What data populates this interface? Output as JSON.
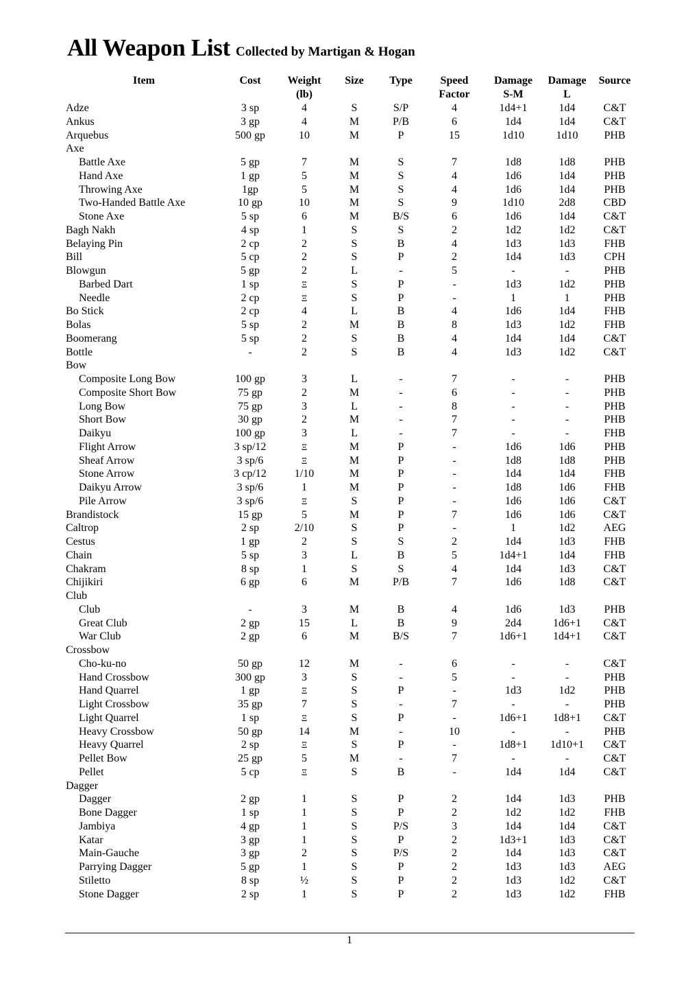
{
  "document": {
    "title": "All Weapon List",
    "subtitle": "Collected by Martigan & Hogan",
    "page_number": "1"
  },
  "table": {
    "headers": {
      "item": "Item",
      "cost": "Cost",
      "weight": [
        "Weight",
        "(lb)"
      ],
      "size": "Size",
      "type": "Type",
      "speed": [
        "Speed",
        "Factor"
      ],
      "damage_sm": [
        "Damage",
        "S-M"
      ],
      "damage_l": [
        "Damage",
        "L"
      ],
      "source": "Source"
    },
    "rows": [
      {
        "item": "Adze",
        "sub": false,
        "cost": "3 sp",
        "weight": "4",
        "size": "S",
        "type": "S/P",
        "speed": "4",
        "dsm": "1d4+1",
        "dl": "1d4",
        "source": "C&T"
      },
      {
        "item": "Ankus",
        "sub": false,
        "cost": "3 gp",
        "weight": "4",
        "size": "M",
        "type": "P/B",
        "speed": "6",
        "dsm": "1d4",
        "dl": "1d4",
        "source": "C&T"
      },
      {
        "item": "Arquebus",
        "sub": false,
        "cost": "500 gp",
        "weight": "10",
        "size": "M",
        "type": "P",
        "speed": "15",
        "dsm": "1d10",
        "dl": "1d10",
        "source": "PHB"
      },
      {
        "item": "Axe",
        "sub": false,
        "group": true
      },
      {
        "item": "Battle Axe",
        "sub": true,
        "cost": "5 gp",
        "weight": "7",
        "size": "M",
        "type": "S",
        "speed": "7",
        "dsm": "1d8",
        "dl": "1d8",
        "source": "PHB"
      },
      {
        "item": "Hand Axe",
        "sub": true,
        "cost": "1 gp",
        "weight": "5",
        "size": "M",
        "type": "S",
        "speed": "4",
        "dsm": "1d6",
        "dl": "1d4",
        "source": "PHB"
      },
      {
        "item": "Throwing Axe",
        "sub": true,
        "cost": "1gp",
        "weight": "5",
        "size": "M",
        "type": "S",
        "speed": "4",
        "dsm": "1d6",
        "dl": "1d4",
        "source": "PHB"
      },
      {
        "item": "Two-Handed Battle Axe",
        "sub": true,
        "cost": "10 gp",
        "weight": "10",
        "size": "M",
        "type": "S",
        "speed": "9",
        "dsm": "1d10",
        "dl": "2d8",
        "source": "CBD"
      },
      {
        "item": "Stone Axe",
        "sub": true,
        "cost": "5 sp",
        "weight": "6",
        "size": "M",
        "type": "B/S",
        "speed": "6",
        "dsm": "1d6",
        "dl": "1d4",
        "source": "C&T"
      },
      {
        "item": "Bagh Nakh",
        "sub": false,
        "cost": "4 sp",
        "weight": "1",
        "size": "S",
        "type": "S",
        "speed": "2",
        "dsm": "1d2",
        "dl": "1d2",
        "source": "C&T"
      },
      {
        "item": "Belaying Pin",
        "sub": false,
        "cost": "2 cp",
        "weight": "2",
        "size": "S",
        "type": "B",
        "speed": "4",
        "dsm": "1d3",
        "dl": "1d3",
        "source": "FHB"
      },
      {
        "item": "Bill",
        "sub": false,
        "cost": "5 cp",
        "weight": "2",
        "size": "S",
        "type": "P",
        "speed": "2",
        "dsm": "1d4",
        "dl": "1d3",
        "source": "CPH"
      },
      {
        "item": "Blowgun",
        "sub": false,
        "cost": "5 gp",
        "weight": "2",
        "size": "L",
        "type": "-",
        "speed": "5",
        "dsm": "-",
        "dl": "-",
        "source": "PHB"
      },
      {
        "item": "Barbed Dart",
        "sub": true,
        "cost": "1 sp",
        "weight": "Ξ",
        "size": "S",
        "type": "P",
        "speed": "-",
        "dsm": "1d3",
        "dl": "1d2",
        "source": "PHB"
      },
      {
        "item": "Needle",
        "sub": true,
        "cost": "2 cp",
        "weight": "Ξ",
        "size": "S",
        "type": "P",
        "speed": "-",
        "dsm": "1",
        "dl": "1",
        "source": "PHB"
      },
      {
        "item": "Bo Stick",
        "sub": false,
        "cost": "2 cp",
        "weight": "4",
        "size": "L",
        "type": "B",
        "speed": "4",
        "dsm": "1d6",
        "dl": "1d4",
        "source": "FHB"
      },
      {
        "item": "Bolas",
        "sub": false,
        "cost": "5 sp",
        "weight": "2",
        "size": "M",
        "type": "B",
        "speed": "8",
        "dsm": "1d3",
        "dl": "1d2",
        "source": "FHB"
      },
      {
        "item": "Boomerang",
        "sub": false,
        "cost": "5 sp",
        "weight": "2",
        "size": "S",
        "type": "B",
        "speed": "4",
        "dsm": "1d4",
        "dl": "1d4",
        "source": "C&T"
      },
      {
        "item": "Bottle",
        "sub": false,
        "cost": "-",
        "weight": "2",
        "size": "S",
        "type": "B",
        "speed": "4",
        "dsm": "1d3",
        "dl": "1d2",
        "source": "C&T"
      },
      {
        "item": "Bow",
        "sub": false,
        "group": true
      },
      {
        "item": "Composite Long Bow",
        "sub": true,
        "cost": "100 gp",
        "weight": "3",
        "size": "L",
        "type": "-",
        "speed": "7",
        "dsm": "-",
        "dl": "-",
        "source": "PHB"
      },
      {
        "item": "Composite Short Bow",
        "sub": true,
        "cost": "75 gp",
        "weight": "2",
        "size": "M",
        "type": "-",
        "speed": "6",
        "dsm": "-",
        "dl": "-",
        "source": "PHB"
      },
      {
        "item": "Long Bow",
        "sub": true,
        "cost": "75 gp",
        "weight": "3",
        "size": "L",
        "type": "-",
        "speed": "8",
        "dsm": "-",
        "dl": "-",
        "source": "PHB"
      },
      {
        "item": "Short Bow",
        "sub": true,
        "cost": "30 gp",
        "weight": "2",
        "size": "M",
        "type": "-",
        "speed": "7",
        "dsm": "-",
        "dl": "-",
        "source": "PHB"
      },
      {
        "item": "Daikyu",
        "sub": true,
        "cost": "100 gp",
        "weight": "3",
        "size": "L",
        "type": "-",
        "speed": "7",
        "dsm": "-",
        "dl": "-",
        "source": "FHB"
      },
      {
        "item": "Flight Arrow",
        "sub": true,
        "cost": "3 sp/12",
        "weight": "Ξ",
        "size": "M",
        "type": "P",
        "speed": "-",
        "dsm": "1d6",
        "dl": "1d6",
        "source": "PHB"
      },
      {
        "item": "Sheaf Arrow",
        "sub": true,
        "cost": "3 sp/6",
        "weight": "Ξ",
        "size": "M",
        "type": "P",
        "speed": "-",
        "dsm": "1d8",
        "dl": "1d8",
        "source": "PHB"
      },
      {
        "item": "Stone Arrow",
        "sub": true,
        "cost": "3 cp/12",
        "weight": "1/10",
        "size": "M",
        "type": "P",
        "speed": "-",
        "dsm": "1d4",
        "dl": "1d4",
        "source": "FHB"
      },
      {
        "item": "Daikyu Arrow",
        "sub": true,
        "cost": "3 sp/6",
        "weight": "1",
        "size": "M",
        "type": "P",
        "speed": "-",
        "dsm": "1d8",
        "dl": "1d6",
        "source": "FHB"
      },
      {
        "item": "Pile Arrow",
        "sub": true,
        "cost": "3 sp/6",
        "weight": "Ξ",
        "size": "S",
        "type": "P",
        "speed": "-",
        "dsm": "1d6",
        "dl": "1d6",
        "source": "C&T"
      },
      {
        "item": "Brandistock",
        "sub": false,
        "cost": "15 gp",
        "weight": "5",
        "size": "M",
        "type": "P",
        "speed": "7",
        "dsm": "1d6",
        "dl": "1d6",
        "source": "C&T"
      },
      {
        "item": "Caltrop",
        "sub": false,
        "cost": "2 sp",
        "weight": "2/10",
        "size": "S",
        "type": "P",
        "speed": "-",
        "dsm": "1",
        "dl": "1d2",
        "source": "AEG"
      },
      {
        "item": "Cestus",
        "sub": false,
        "cost": "1 gp",
        "weight": "2",
        "size": "S",
        "type": "S",
        "speed": "2",
        "dsm": "1d4",
        "dl": "1d3",
        "source": "FHB"
      },
      {
        "item": "Chain",
        "sub": false,
        "cost": "5 sp",
        "weight": "3",
        "size": "L",
        "type": "B",
        "speed": "5",
        "dsm": "1d4+1",
        "dl": "1d4",
        "source": "FHB"
      },
      {
        "item": "Chakram",
        "sub": false,
        "cost": "8 sp",
        "weight": "1",
        "size": "S",
        "type": "S",
        "speed": "4",
        "dsm": "1d4",
        "dl": "1d3",
        "source": "C&T"
      },
      {
        "item": "Chijikiri",
        "sub": false,
        "cost": "6 gp",
        "weight": "6",
        "size": "M",
        "type": "P/B",
        "speed": "7",
        "dsm": "1d6",
        "dl": "1d8",
        "source": "C&T"
      },
      {
        "item": "Club",
        "sub": false,
        "group": true
      },
      {
        "item": "Club",
        "sub": true,
        "cost": "-",
        "weight": "3",
        "size": "M",
        "type": "B",
        "speed": "4",
        "dsm": "1d6",
        "dl": "1d3",
        "source": "PHB"
      },
      {
        "item": "Great Club",
        "sub": true,
        "cost": "2 gp",
        "weight": "15",
        "size": "L",
        "type": "B",
        "speed": "9",
        "dsm": "2d4",
        "dl": "1d6+1",
        "source": "C&T"
      },
      {
        "item": "War Club",
        "sub": true,
        "cost": "2 gp",
        "weight": "6",
        "size": "M",
        "type": "B/S",
        "speed": "7",
        "dsm": "1d6+1",
        "dl": "1d4+1",
        "source": "C&T"
      },
      {
        "item": "Crossbow",
        "sub": false,
        "group": true
      },
      {
        "item": "Cho-ku-no",
        "sub": true,
        "cost": "50 gp",
        "weight": "12",
        "size": "M",
        "type": "-",
        "speed": "6",
        "dsm": "-",
        "dl": "-",
        "source": "C&T"
      },
      {
        "item": "Hand Crossbow",
        "sub": true,
        "cost": "300 gp",
        "weight": "3",
        "size": "S",
        "type": "-",
        "speed": "5",
        "dsm": "-",
        "dl": "-",
        "source": "PHB"
      },
      {
        "item": "Hand Quarrel",
        "sub": true,
        "cost": "1 gp",
        "weight": "Ξ",
        "size": "S",
        "type": "P",
        "speed": "-",
        "dsm": "1d3",
        "dl": "1d2",
        "source": "PHB"
      },
      {
        "item": "Light Crossbow",
        "sub": true,
        "cost": "35 gp",
        "weight": "7",
        "size": "S",
        "type": "-",
        "speed": "7",
        "dsm": "-",
        "dl": "-",
        "source": "PHB"
      },
      {
        "item": "Light Quarrel",
        "sub": true,
        "cost": "1 sp",
        "weight": "Ξ",
        "size": "S",
        "type": "P",
        "speed": "-",
        "dsm": "1d6+1",
        "dl": "1d8+1",
        "source": "C&T"
      },
      {
        "item": "Heavy Crossbow",
        "sub": true,
        "cost": "50 gp",
        "weight": "14",
        "size": "M",
        "type": "-",
        "speed": "10",
        "dsm": "-",
        "dl": "-",
        "source": "PHB"
      },
      {
        "item": "Heavy Quarrel",
        "sub": true,
        "cost": "2 sp",
        "weight": "Ξ",
        "size": "S",
        "type": "P",
        "speed": "-",
        "dsm": "1d8+1",
        "dl": "1d10+1",
        "source": "C&T"
      },
      {
        "item": "Pellet Bow",
        "sub": true,
        "cost": "25 gp",
        "weight": "5",
        "size": "M",
        "type": "-",
        "speed": "7",
        "dsm": "-",
        "dl": "-",
        "source": "C&T"
      },
      {
        "item": "Pellet",
        "sub": true,
        "cost": "5 cp",
        "weight": "Ξ",
        "size": "S",
        "type": "B",
        "speed": "-",
        "dsm": "1d4",
        "dl": "1d4",
        "source": "C&T"
      },
      {
        "item": "Dagger",
        "sub": false,
        "group": true
      },
      {
        "item": "Dagger",
        "sub": true,
        "cost": "2 gp",
        "weight": "1",
        "size": "S",
        "type": "P",
        "speed": "2",
        "dsm": "1d4",
        "dl": "1d3",
        "source": "PHB"
      },
      {
        "item": "Bone Dagger",
        "sub": true,
        "cost": "1 sp",
        "weight": "1",
        "size": "S",
        "type": "P",
        "speed": "2",
        "dsm": "1d2",
        "dl": "1d2",
        "source": "FHB"
      },
      {
        "item": "Jambiya",
        "sub": true,
        "cost": "4 gp",
        "weight": "1",
        "size": "S",
        "type": "P/S",
        "speed": "3",
        "dsm": "1d4",
        "dl": "1d4",
        "source": "C&T"
      },
      {
        "item": "Katar",
        "sub": true,
        "cost": "3 gp",
        "weight": "1",
        "size": "S",
        "type": "P",
        "speed": "2",
        "dsm": "1d3+1",
        "dl": "1d3",
        "source": "C&T"
      },
      {
        "item": "Main-Gauche",
        "sub": true,
        "cost": "3 gp",
        "weight": "2",
        "size": "S",
        "type": "P/S",
        "speed": "2",
        "dsm": "1d4",
        "dl": "1d3",
        "source": "C&T"
      },
      {
        "item": "Parrying Dagger",
        "sub": true,
        "cost": "5 gp",
        "weight": "1",
        "size": "S",
        "type": "P",
        "speed": "2",
        "dsm": "1d3",
        "dl": "1d3",
        "source": "AEG"
      },
      {
        "item": "Stiletto",
        "sub": true,
        "cost": "8 sp",
        "weight": "½",
        "size": "S",
        "type": "P",
        "speed": "2",
        "dsm": "1d3",
        "dl": "1d2",
        "source": "C&T"
      },
      {
        "item": "Stone Dagger",
        "sub": true,
        "cost": "2 sp",
        "weight": "1",
        "size": "S",
        "type": "P",
        "speed": "2",
        "dsm": "1d3",
        "dl": "1d2",
        "source": "FHB"
      }
    ]
  }
}
